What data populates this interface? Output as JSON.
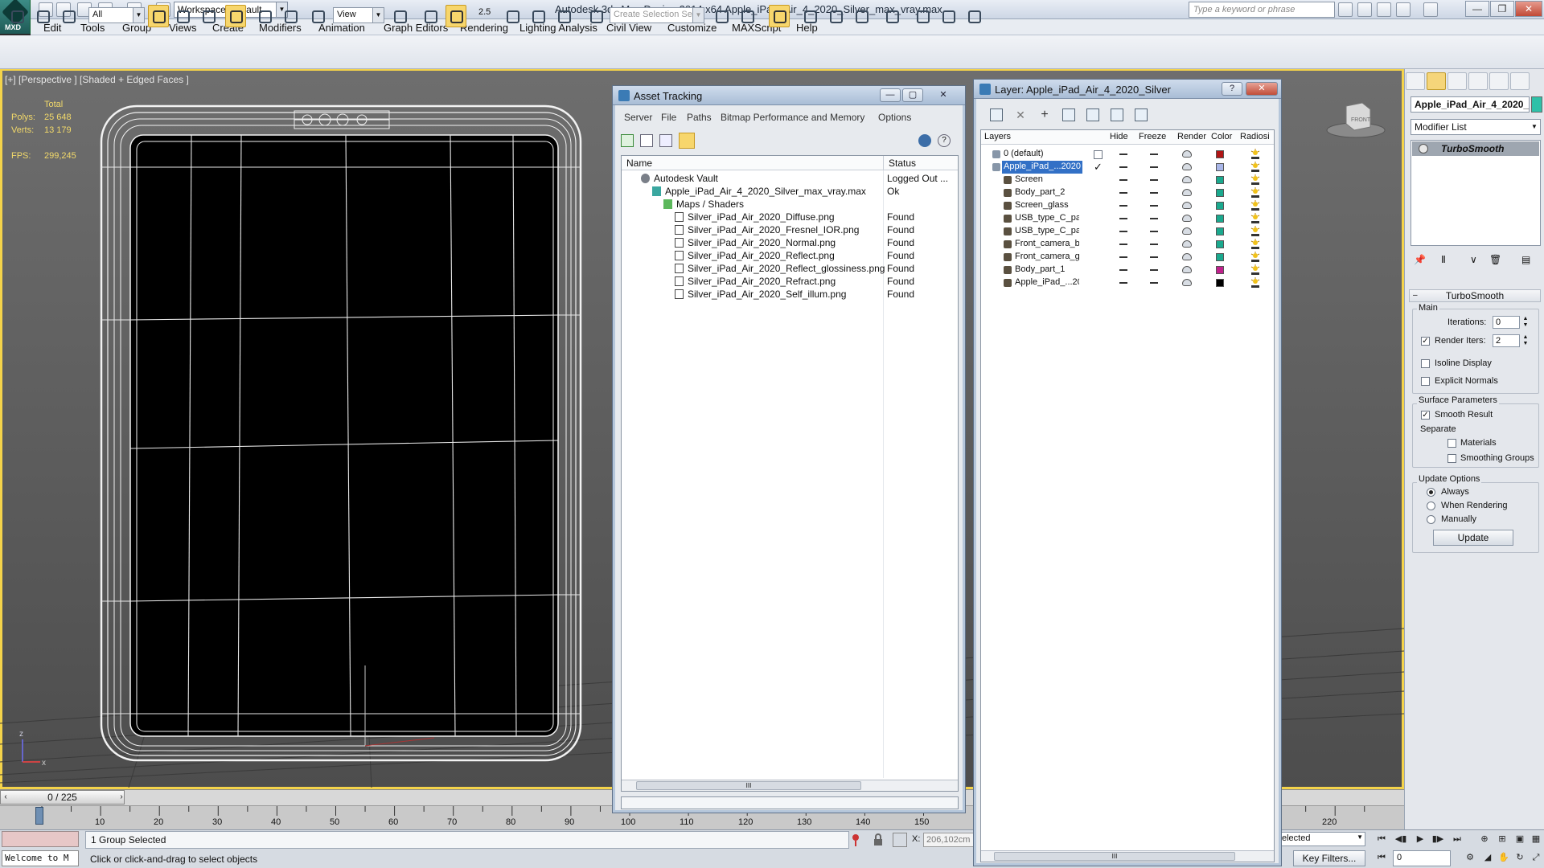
{
  "app": {
    "title": "Autodesk 3ds Max Design 2014 x64     Apple_iPad_Air_4_2020_Silver_max_vray.max",
    "app_button_label": "MXD",
    "workspace": "Workspace: Default",
    "search_placeholder": "Type a keyword or phrase"
  },
  "menus": [
    "Edit",
    "Tools",
    "Group",
    "Views",
    "Create",
    "Modifiers",
    "Animation",
    "Graph Editors",
    "Rendering",
    "Lighting Analysis",
    "Civil View",
    "Customize",
    "MAXScript",
    "Help"
  ],
  "toolbar": {
    "selection_filter": "All",
    "ref_coord": "View",
    "snap_value": "2.5",
    "named_selection_placeholder": "Create Selection Se"
  },
  "viewport": {
    "label": "[+] [Perspective ] [Shaded + Edged Faces ]",
    "stats": {
      "total_label": "Total",
      "polys_label": "Polys:",
      "polys": "25 648",
      "verts_label": "Verts:",
      "verts": "13 179",
      "fps_label": "FPS:",
      "fps": "299,245"
    },
    "viewcube_label": "FRONT",
    "axis_z": "z",
    "axis_x": "x"
  },
  "timeline": {
    "position": "0 / 225",
    "ticks": [
      "10",
      "20",
      "30",
      "40",
      "50",
      "60",
      "70",
      "80",
      "90",
      "100",
      "110",
      "120",
      "130",
      "140",
      "150",
      "220"
    ]
  },
  "status": {
    "maxscript": "Welcome to M",
    "selection": "1 Group Selected",
    "prompt": "Click or click-and-drag to select objects",
    "coord_x_label": "X:",
    "coord_x": "206,102cm",
    "key_filters": "Key Filters...",
    "selected_combo": "elected",
    "frame": "0"
  },
  "command_panel": {
    "object_name": "Apple_iPad_Air_4_2020_",
    "object_color": "#2ec1a8",
    "modifier_list": "Modifier List",
    "stack_item": "TurboSmooth",
    "rollout_title": "TurboSmooth",
    "main_group": "Main",
    "iterations_label": "Iterations:",
    "iterations": "0",
    "render_iters_label": "Render Iters:",
    "render_iters": "2",
    "isoline": "Isoline Display",
    "explicit_normals": "Explicit Normals",
    "surface_group": "Surface Parameters",
    "smooth_result": "Smooth Result",
    "separate": "Separate",
    "materials": "Materials",
    "smoothing_groups": "Smoothing Groups",
    "update_group": "Update Options",
    "always": "Always",
    "when_rendering": "When Rendering",
    "manually": "Manually",
    "update_button": "Update"
  },
  "asset_tracking": {
    "title": "Asset Tracking",
    "menus": [
      "Server",
      "File",
      "Paths",
      "Bitmap Performance and Memory",
      "Options"
    ],
    "col_name": "Name",
    "col_status": "Status",
    "rows": [
      {
        "name": "Autodesk Vault",
        "status": "Logged Out ...",
        "indent": 0,
        "icon": "vault-icon"
      },
      {
        "name": "Apple_iPad_Air_4_2020_Silver_max_vray.max",
        "status": "Ok",
        "indent": 1,
        "icon": "max-file-icon"
      },
      {
        "name": "Maps / Shaders",
        "status": "",
        "indent": 2,
        "icon": "maps-folder-icon"
      },
      {
        "name": "Silver_iPad_Air_2020_Diffuse.png",
        "status": "Found",
        "indent": 3,
        "icon": "bitmap-icon"
      },
      {
        "name": "Silver_iPad_Air_2020_Fresnel_IOR.png",
        "status": "Found",
        "indent": 3,
        "icon": "bitmap-icon"
      },
      {
        "name": "Silver_iPad_Air_2020_Normal.png",
        "status": "Found",
        "indent": 3,
        "icon": "bitmap-icon"
      },
      {
        "name": "Silver_iPad_Air_2020_Reflect.png",
        "status": "Found",
        "indent": 3,
        "icon": "bitmap-icon"
      },
      {
        "name": "Silver_iPad_Air_2020_Reflect_glossiness.png",
        "status": "Found",
        "indent": 3,
        "icon": "bitmap-icon"
      },
      {
        "name": "Silver_iPad_Air_2020_Refract.png",
        "status": "Found",
        "indent": 3,
        "icon": "bitmap-icon"
      },
      {
        "name": "Silver_iPad_Air_2020_Self_illum.png",
        "status": "Found",
        "indent": 3,
        "icon": "bitmap-icon"
      }
    ],
    "scroll_grip": "III"
  },
  "layer_window": {
    "title": "Layer: Apple_iPad_Air_4_2020_Silver",
    "help": "?",
    "col_layers": "Layers",
    "col_hide": "Hide",
    "col_freeze": "Freeze",
    "col_render": "Render",
    "col_color": "Color",
    "col_radiosity": "Radiosi",
    "rows": [
      {
        "name": "0 (default)",
        "kind": "layer",
        "color": "#b01515",
        "selected": false
      },
      {
        "name": "Apple_iPad_...2020",
        "kind": "layer",
        "color": "#a9b6e8",
        "selected": true
      },
      {
        "name": "Screen",
        "kind": "object",
        "color": "#1aa98e",
        "selected": false
      },
      {
        "name": "Body_part_2",
        "kind": "object",
        "color": "#1aa98e",
        "selected": false
      },
      {
        "name": "Screen_glass",
        "kind": "object",
        "color": "#1aa98e",
        "selected": false
      },
      {
        "name": "USB_type_C_pa",
        "kind": "object",
        "color": "#1aa98e",
        "selected": false
      },
      {
        "name": "USB_type_C_pa",
        "kind": "object",
        "color": "#1aa98e",
        "selected": false
      },
      {
        "name": "Front_camera_b",
        "kind": "object",
        "color": "#1aa98e",
        "selected": false
      },
      {
        "name": "Front_camera_g",
        "kind": "object",
        "color": "#1aa98e",
        "selected": false
      },
      {
        "name": "Body_part_1",
        "kind": "object",
        "color": "#c0208c",
        "selected": false
      },
      {
        "name": "Apple_iPad_...20",
        "kind": "object",
        "color": "#000000",
        "selected": false
      }
    ],
    "check_mark": "✓",
    "scroll_grip": "III"
  }
}
